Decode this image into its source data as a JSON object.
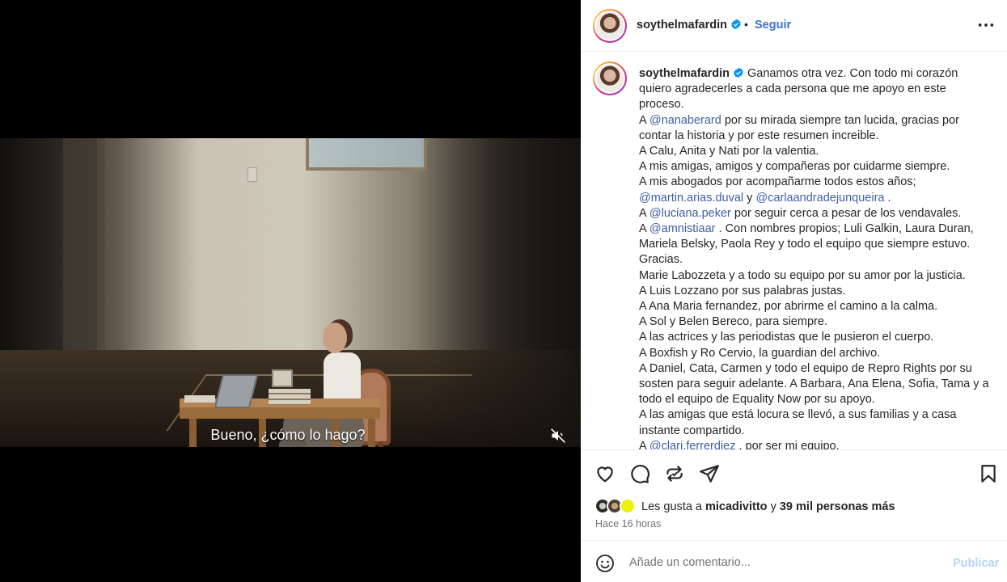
{
  "video": {
    "subtitle": "Bueno, ¿cómo lo hago?",
    "mute_icon": "speaker-muted-icon"
  },
  "post": {
    "username": "soythelmafardin",
    "verified": true,
    "follow_label": "Seguir",
    "separator": "•",
    "more_icon": "more-horizontal-icon",
    "caption": {
      "lines": [
        [
          {
            "t": "text",
            "v": " Ganamos otra vez. Con todo mi corazón"
          }
        ],
        [
          {
            "t": "text",
            "v": "quiero agradecerles a cada persona que me apoyo en este"
          }
        ],
        [
          {
            "t": "text",
            "v": "proceso."
          }
        ],
        [
          {
            "t": "text",
            "v": "A "
          },
          {
            "t": "mention",
            "v": "@nanaberard"
          },
          {
            "t": "text",
            "v": " por su mirada siempre tan lucida, gracias por"
          }
        ],
        [
          {
            "t": "text",
            "v": "contar la historia y por este resumen increible."
          }
        ],
        [
          {
            "t": "text",
            "v": "A Calu, Anita y Nati por la valentia."
          }
        ],
        [
          {
            "t": "text",
            "v": "A mis amigas, amigos y compañeras por cuidarme siempre."
          }
        ],
        [
          {
            "t": "text",
            "v": "A mis abogados por acompañarme todos estos años;"
          }
        ],
        [
          {
            "t": "mention",
            "v": "@martin.arias.duval"
          },
          {
            "t": "text",
            "v": " y "
          },
          {
            "t": "mention",
            "v": "@carlaandradejunqueira"
          },
          {
            "t": "text",
            "v": " ."
          }
        ],
        [
          {
            "t": "text",
            "v": "A "
          },
          {
            "t": "mention",
            "v": "@luciana.peker"
          },
          {
            "t": "text",
            "v": " por seguir cerca a pesar de los vendavales."
          }
        ],
        [
          {
            "t": "text",
            "v": "A "
          },
          {
            "t": "mention",
            "v": "@amnistiaar"
          },
          {
            "t": "text",
            "v": " . Con nombres propios; Luli Galkin, Laura Duran,"
          }
        ],
        [
          {
            "t": "text",
            "v": "Mariela Belsky, Paola Rey y todo el equipo que siempre estuvo."
          }
        ],
        [
          {
            "t": "text",
            "v": "Gracias."
          }
        ],
        [
          {
            "t": "text",
            "v": "Marie Labozzeta y a todo su equipo por su amor por la justicia."
          }
        ],
        [
          {
            "t": "text",
            "v": "A Luis Lozzano por sus palabras justas."
          }
        ],
        [
          {
            "t": "text",
            "v": "A Ana Maria fernandez, por abrirme el camino a la calma."
          }
        ],
        [
          {
            "t": "text",
            "v": "A Sol y Belen Bereco, para siempre."
          }
        ],
        [
          {
            "t": "text",
            "v": "A las actrices y las periodistas que le pusieron el cuerpo."
          }
        ],
        [
          {
            "t": "text",
            "v": "A Boxfish y Ro Cervio, la guardian del archivo."
          }
        ],
        [
          {
            "t": "text",
            "v": "A Daniel, Cata, Carmen y todo el equipo de Repro Rights por su"
          }
        ],
        [
          {
            "t": "text",
            "v": "sosten para seguir adelante. A Barbara, Ana Elena, Sofia, Tama y a"
          }
        ],
        [
          {
            "t": "text",
            "v": "todo el equipo de Equality Now por su apoyo."
          }
        ],
        [
          {
            "t": "text",
            "v": "A las amigas que está locura se llevó, a sus familias y a casa"
          }
        ],
        [
          {
            "t": "text",
            "v": "instante compartido."
          }
        ],
        [
          {
            "t": "text",
            "v": "A "
          },
          {
            "t": "mention",
            "v": "@clari.ferrerdiez"
          },
          {
            "t": "text",
            "v": " . por ser mi equipo."
          }
        ]
      ]
    },
    "actions": {
      "like_icon": "heart-icon",
      "comment_icon": "comment-icon",
      "repost_icon": "repost-icon",
      "share_icon": "share-icon",
      "save_icon": "bookmark-icon"
    },
    "likes": {
      "prefix": "Les gusta a ",
      "user": "micadivitto",
      "connector": " y ",
      "others": "39 mil personas más"
    },
    "time_ago": "Hace 16 horas",
    "comment": {
      "placeholder": "Añade un comentario...",
      "publish_label": "Publicar",
      "emoji_icon": "emoji-icon"
    },
    "colors": {
      "link": "#3f5ea8",
      "follow": "#3e6fd8",
      "publish_disabled": "#b3d3f7",
      "verified": "#0095f6"
    }
  }
}
